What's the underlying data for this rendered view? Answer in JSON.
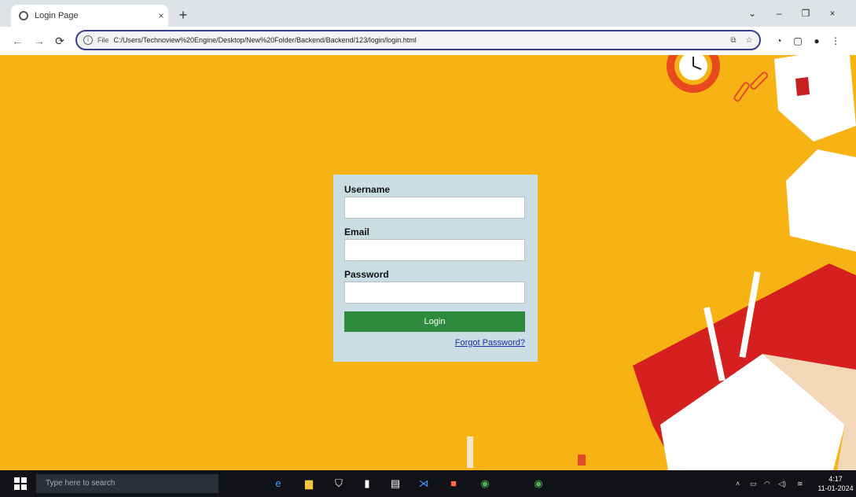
{
  "browser": {
    "tab": {
      "title": "Login Page",
      "close": "×"
    },
    "new_tab": "+",
    "window_controls": {
      "minimize": "–",
      "maximize": "❐",
      "close": "×",
      "dropdown": "⌄"
    },
    "nav": {
      "back": "←",
      "forward": "→",
      "reload": "⟳"
    },
    "omnibox": {
      "scheme_label": "File",
      "url": "C:/Users/Technoview%20Engine/Desktop/New%20Folder/Backend/Backend/123/login/login.html"
    }
  },
  "login": {
    "username_label": "Username",
    "email_label": "Email",
    "password_label": "Password",
    "username_value": "",
    "email_value": "",
    "password_value": "",
    "login_button": "Login",
    "forgot_link": "Forgot Password?"
  },
  "taskbar": {
    "search_placeholder": "Type here to search",
    "time": "4:17",
    "date": "11-01-2024"
  },
  "colors": {
    "background": "#f7b314",
    "card": "#c9dde3",
    "login_button": "#2e8b3d",
    "link": "#1a2fa8",
    "deco_red": "#d61f1f"
  }
}
